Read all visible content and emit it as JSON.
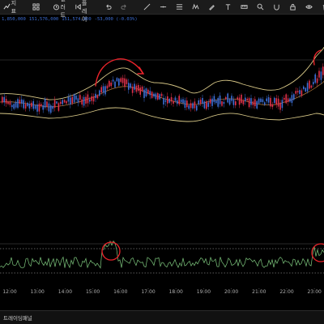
{
  "toolbar": {
    "indicator_label": "지표",
    "alert_label": "얼러트",
    "replay_label": "리플레이"
  },
  "infobar": {
    "open": "1,850,000",
    "high": "151,576,000",
    "close": "151,574,000",
    "change": "-53,000 (-0.03%)"
  },
  "time_axis": [
    "12:00",
    "13:00",
    "14:00",
    "15:00",
    "16:00",
    "17:00",
    "18:00",
    "19:00",
    "20:00",
    "21:00",
    "22:00",
    "23:00"
  ],
  "status": {
    "panel_label": "트레이딩패널"
  },
  "colors": {
    "up": "#e2314b",
    "down": "#3d6fd8",
    "band": "#d8c887",
    "osc": "#7ec87e",
    "annotation": "#e8232a"
  }
}
